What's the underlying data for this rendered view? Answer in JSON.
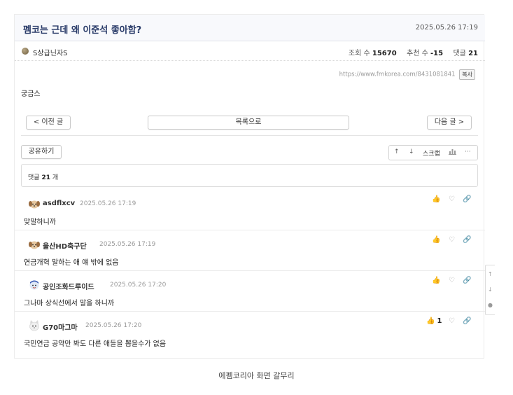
{
  "post": {
    "title": "펨코는 근데 왜 이준석 좋아함?",
    "date": "2025.05.26 17:19",
    "author": "S상급닌자S",
    "author_icon": "level-badge-icon",
    "stats": {
      "views_label": "조회 수",
      "views": "15670",
      "votes_label": "추천 수",
      "votes": "-15",
      "comments_label": "댓글",
      "comments": "21"
    },
    "url": "https://www.fmkorea.com/8431081841",
    "copy_label": "복사",
    "body": "궁금스"
  },
  "nav": {
    "prev": "< 이전 글",
    "list": "목록으로",
    "next": "다음 글 >"
  },
  "actions": {
    "share": "공유하기",
    "up_icon": "↑",
    "down_icon": "↓",
    "scrap": "스크랩",
    "chart_icon": "bar-chart-icon",
    "more": "···"
  },
  "comment_summary": {
    "label": "댓글",
    "count": "21",
    "unit": "개"
  },
  "comments": [
    {
      "author": "asdflxcv",
      "date": "2025.05.26 17:19",
      "text": "맞말하니까",
      "avatar": "dog-avatar-icon",
      "likes": ""
    },
    {
      "author": "울산HD축구단",
      "date": "2025.05.26 17:19",
      "text": "연금개혁 말하는 애 얘 밖에 없음",
      "avatar": "dog-avatar-icon",
      "likes": ""
    },
    {
      "author": "공인조화드루이드",
      "date": "2025.05.26 17:20",
      "text": "그나마 상식선에서 말을 하니까",
      "avatar": "character-avatar-icon",
      "likes": ""
    },
    {
      "author": "G70마그마",
      "date": "2025.05.26 17:20",
      "text": "국민연금 공약만 봐도 다른 애들을 뽑을수가 없음",
      "avatar": "cat-avatar-icon",
      "likes": "1"
    }
  ],
  "caption": "에펨코리아 화면 갈무리",
  "colors": {
    "title": "#283a68",
    "title_bg": "#f8f9fc",
    "border": "#dcdcdc",
    "muted": "#999999"
  }
}
